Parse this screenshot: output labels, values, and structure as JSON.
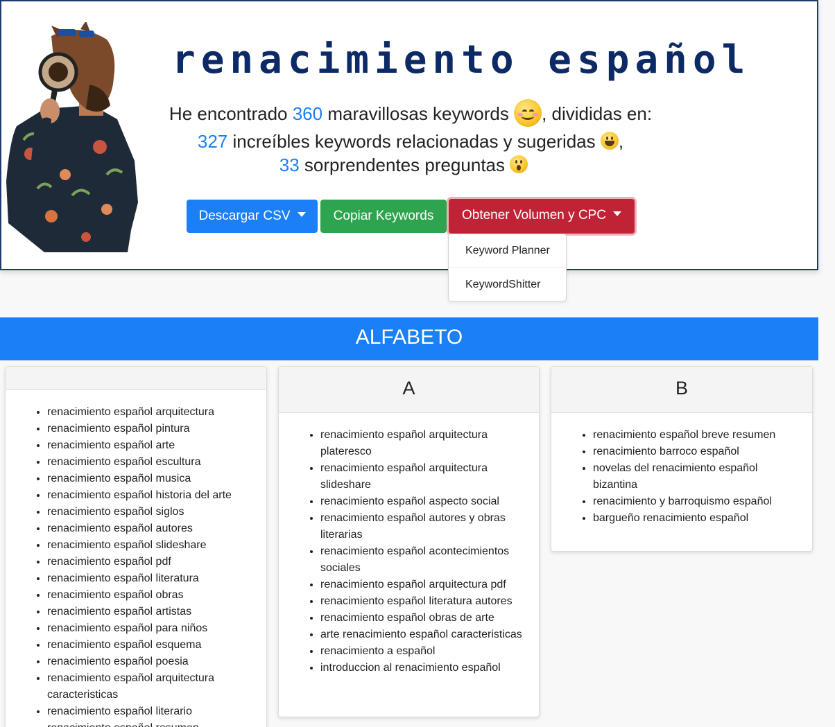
{
  "hero": {
    "title": "renacimiento español",
    "line1_prefix": "He encontrado ",
    "line1_num": "360",
    "line1_suffix": " maravillosas keywords",
    "line1_end": ", divididas en:",
    "line2_num": "327",
    "line2_text": " increíbles keywords relacionadas y sugeridas",
    "line2_end": ",",
    "line3_num": "33",
    "line3_text": " sorprendentes preguntas",
    "icons": [
      "smiling-face-emoji",
      "grinning-face-emoji",
      "astonished-face-emoji"
    ],
    "colors": {
      "number": "#1a80f5",
      "title": "#0c2a66"
    }
  },
  "buttons": {
    "csv": "Descargar CSV",
    "copy": "Copiar Keywords",
    "volume": "Obtener Volumen y CPC",
    "colors": {
      "csv": "#1b7ff6",
      "copy": "#2ea44f",
      "volume": "#c12336"
    }
  },
  "dropdown": {
    "items": [
      "Keyword Planner",
      "KeywordShitter"
    ]
  },
  "alfabeto": {
    "title": "ALFABETO",
    "color": "#1b7ff6"
  },
  "cards": [
    {
      "heading": "",
      "items": [
        "renacimiento español arquitectura",
        "renacimiento español pintura",
        "renacimiento español arte",
        "renacimiento español escultura",
        "renacimiento español musica",
        "renacimiento español historia del arte",
        "renacimiento español siglos",
        "renacimiento español autores",
        "renacimiento español slideshare",
        "renacimiento español pdf",
        "renacimiento español literatura",
        "renacimiento español obras",
        "renacimiento español artistas",
        "renacimiento español para niños",
        "renacimiento español esquema",
        "renacimiento español poesia",
        "renacimiento español arquitectura caracteristicas",
        "renacimiento español literario",
        "renacimiento español resumen"
      ]
    },
    {
      "heading": "A",
      "items": [
        "renacimiento español arquitectura plateresco",
        "renacimiento español arquitectura slideshare",
        "renacimiento español aspecto social",
        "renacimiento español autores y obras literarias",
        "renacimiento español acontecimientos sociales",
        "renacimiento español arquitectura pdf",
        "renacimiento español literatura autores",
        "renacimiento español obras de arte",
        "arte renacimiento español caracteristicas",
        "renacimiento a español",
        "introduccion al renacimiento español"
      ]
    },
    {
      "heading": "B",
      "items": [
        "renacimiento español breve resumen",
        "renacimiento barroco español",
        "novelas del renacimiento español bizantina",
        "renacimiento y barroquismo español",
        "bargueño renacimiento español"
      ]
    }
  ]
}
